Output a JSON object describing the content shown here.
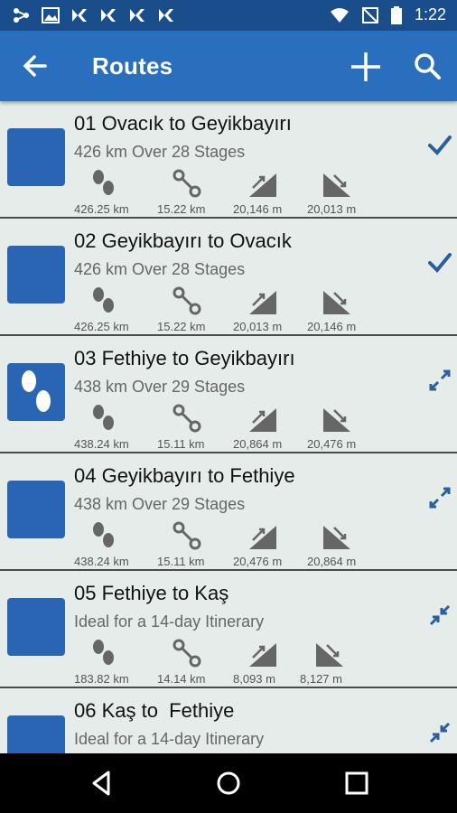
{
  "status_bar": {
    "time": "1:22",
    "left_icons": [
      "share-icon",
      "image-icon",
      "app-icon",
      "app-icon",
      "app-icon",
      "app-icon"
    ],
    "right_icons": [
      "wifi-icon",
      "no-signal-icon",
      "battery-icon"
    ]
  },
  "app_bar": {
    "title": "Routes",
    "back_icon": "arrow-back-icon",
    "add_icon": "plus-icon",
    "search_icon": "search-icon",
    "color": "#2a6fbe"
  },
  "routes": [
    {
      "title": "01 Ovacık to Geyikbayırı",
      "subtitle": "426 km Over 28 Stages",
      "distance": "426.25 km",
      "interval": "15.22 km",
      "ascent": "20,146 m",
      "descent": "20,013 m",
      "status": "check-icon",
      "thumb_icon": ""
    },
    {
      "title": "02 Geyikbayırı to Ovacık",
      "subtitle": "426 km Over 28 Stages",
      "distance": "426.25 km",
      "interval": "15.22 km",
      "ascent": "20,013 m",
      "descent": "20,146 m",
      "status": "check-icon",
      "thumb_icon": ""
    },
    {
      "title": "03 Fethiye to Geyikbayırı",
      "subtitle": "438 km Over 29 Stages",
      "distance": "438.24 km",
      "interval": "15.11 km",
      "ascent": "20,864 m",
      "descent": "20,476 m",
      "status": "expand-icon",
      "thumb_icon": "footprints-icon"
    },
    {
      "title": "04 Geyikbayırı to Fethiye",
      "subtitle": "438 km Over 29 Stages",
      "distance": "438.24 km",
      "interval": "15.11 km",
      "ascent": "20,476 m",
      "descent": "20,864 m",
      "status": "expand-icon",
      "thumb_icon": ""
    },
    {
      "title": "05 Fethiye to Kaş",
      "subtitle": "Ideal for a 14-day Itinerary",
      "distance": "183.82 km",
      "interval": "14.14 km",
      "ascent": "8,093 m",
      "descent": "8,127 m",
      "status": "expand-icon",
      "thumb_icon": ""
    },
    {
      "title": "06 Kaş to  Fethiye",
      "subtitle": "Ideal for a 14-day Itinerary",
      "distance": "",
      "interval": "",
      "ascent": "",
      "descent": "",
      "status": "expand-icon",
      "thumb_icon": ""
    }
  ],
  "nav_bar": {
    "back": "nav-back-icon",
    "home": "nav-home-icon",
    "recents": "nav-recents-icon"
  }
}
